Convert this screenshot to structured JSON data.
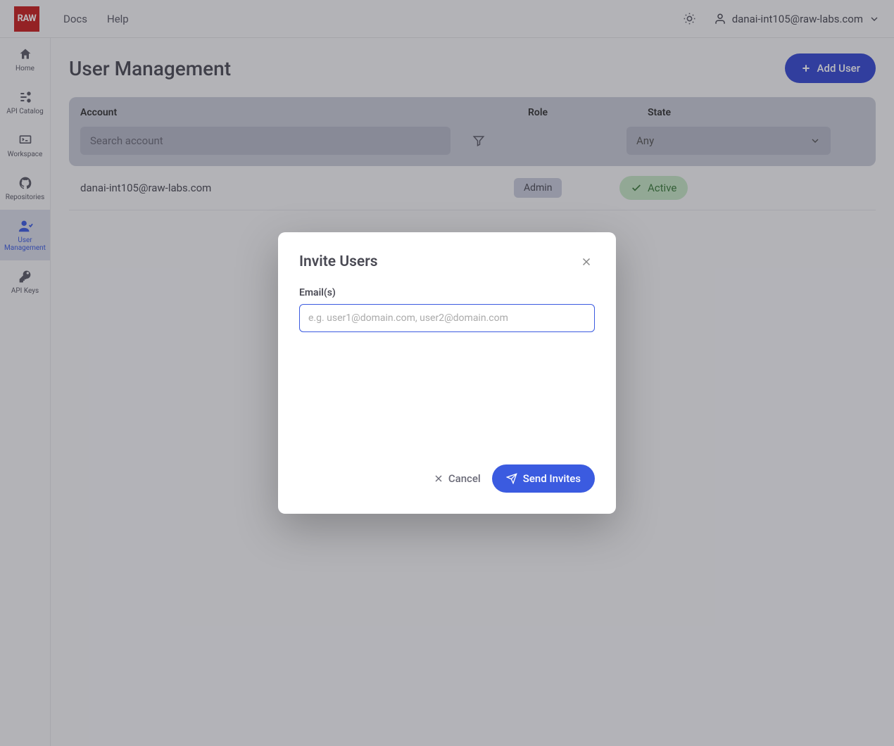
{
  "brand": "RAW",
  "topnav": {
    "docs": "Docs",
    "help": "Help",
    "user_email": "danai-int105@raw-labs.com"
  },
  "sidebar": {
    "items": [
      {
        "label": "Home"
      },
      {
        "label": "API Catalog"
      },
      {
        "label": "Workspace"
      },
      {
        "label": "Repositories"
      },
      {
        "label": "User Management"
      },
      {
        "label": "API Keys"
      }
    ]
  },
  "page": {
    "title": "User Management",
    "add_user": "Add User"
  },
  "table": {
    "headers": {
      "account": "Account",
      "role": "Role",
      "state": "State"
    },
    "search_placeholder": "Search account",
    "state_filter": "Any",
    "rows": [
      {
        "account": "danai-int105@raw-labs.com",
        "role": "Admin",
        "state": "Active"
      }
    ]
  },
  "modal": {
    "title": "Invite Users",
    "email_label": "Email(s)",
    "email_placeholder": "e.g. user1@domain.com, user2@domain.com",
    "cancel": "Cancel",
    "send": "Send Invites"
  }
}
